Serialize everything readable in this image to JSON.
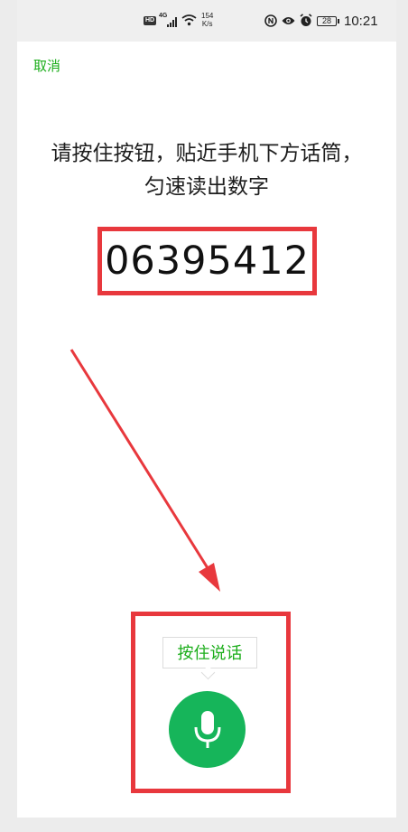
{
  "status_bar": {
    "hd": "HD",
    "signal": "4G",
    "net_speed_value": "154",
    "net_speed_unit": "K/s",
    "battery": "28",
    "time": "10:21"
  },
  "header": {
    "cancel_label": "取消"
  },
  "instruction": {
    "line1": "请按住按钮，贴近手机下方话筒，",
    "line2": "匀速读出数字"
  },
  "verification": {
    "digits": "06395412"
  },
  "voice": {
    "hint_label": "按住说话"
  },
  "colors": {
    "accent_green": "#1aad19",
    "mic_button": "#16b55a",
    "annotation_red": "#e8383d"
  },
  "icons": [
    "wifi-icon",
    "nfc-icon",
    "eye-icon",
    "alarm-icon",
    "battery-icon",
    "microphone-icon"
  ]
}
